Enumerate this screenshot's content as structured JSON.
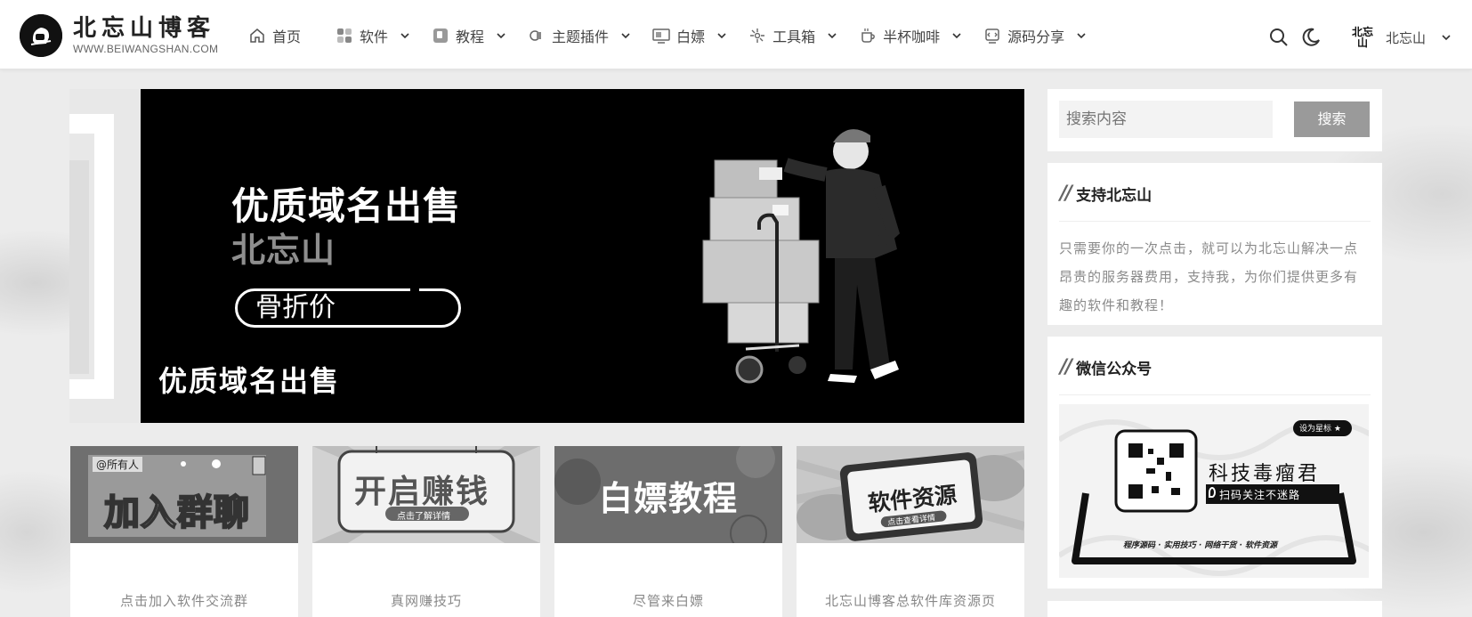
{
  "site": {
    "title": "北忘山博客",
    "domain": "WWW.BEIWANGSHAN.COM"
  },
  "nav": [
    {
      "label": "首页",
      "icon": "home-icon",
      "has_dropdown": false
    },
    {
      "label": "软件",
      "icon": "apps-icon",
      "has_dropdown": true
    },
    {
      "label": "教程",
      "icon": "book-icon",
      "has_dropdown": true
    },
    {
      "label": "主题插件",
      "icon": "puzzle-icon",
      "has_dropdown": true
    },
    {
      "label": "白嫖",
      "icon": "gift-icon",
      "has_dropdown": true
    },
    {
      "label": "工具箱",
      "icon": "tools-icon",
      "has_dropdown": true
    },
    {
      "label": "半杯咖啡",
      "icon": "coffee-icon",
      "has_dropdown": true
    },
    {
      "label": "源码分享",
      "icon": "code-icon",
      "has_dropdown": true
    }
  ],
  "header_right": {
    "user_name": "北忘山",
    "avatar_text": "北忘山"
  },
  "banner": {
    "title": "优质域名出售",
    "subtitle": "北忘山",
    "pill": "骨折价",
    "caption": "优质域名出售"
  },
  "cards": [
    {
      "label": "点击加入软件交流群",
      "thumb_text": "加入群聊",
      "tag": "@所有人"
    },
    {
      "label": "真网赚技巧",
      "thumb_text": "开启赚钱",
      "tag": "点击了解详情"
    },
    {
      "label": "尽管来白嫖",
      "thumb_text": "白嫖教程",
      "tag": ""
    },
    {
      "label": "北忘山博客总软件库资源页",
      "thumb_text": "软件资源",
      "tag": "点击查看详情"
    }
  ],
  "sidebar": {
    "search": {
      "placeholder": "搜索内容",
      "button": "搜索"
    },
    "support": {
      "title": "支持北忘山",
      "text": "只需要你的一次点击，就可以为北忘山解决一点昂贵的服务器费用，支持我，为你们提供更多有趣的软件和教程！"
    },
    "wechat": {
      "title": "微信公众号",
      "name": "科技毒瘤君",
      "star": "设为星标 ★",
      "tagline": "扫码关注不迷路",
      "footer": "程序源码 · 实用技巧 · 网络干货 · 软件资源"
    }
  },
  "colors": {
    "header_bg": "#ffffff",
    "banner_bg": "#000000",
    "button": "#9a9a9a"
  }
}
